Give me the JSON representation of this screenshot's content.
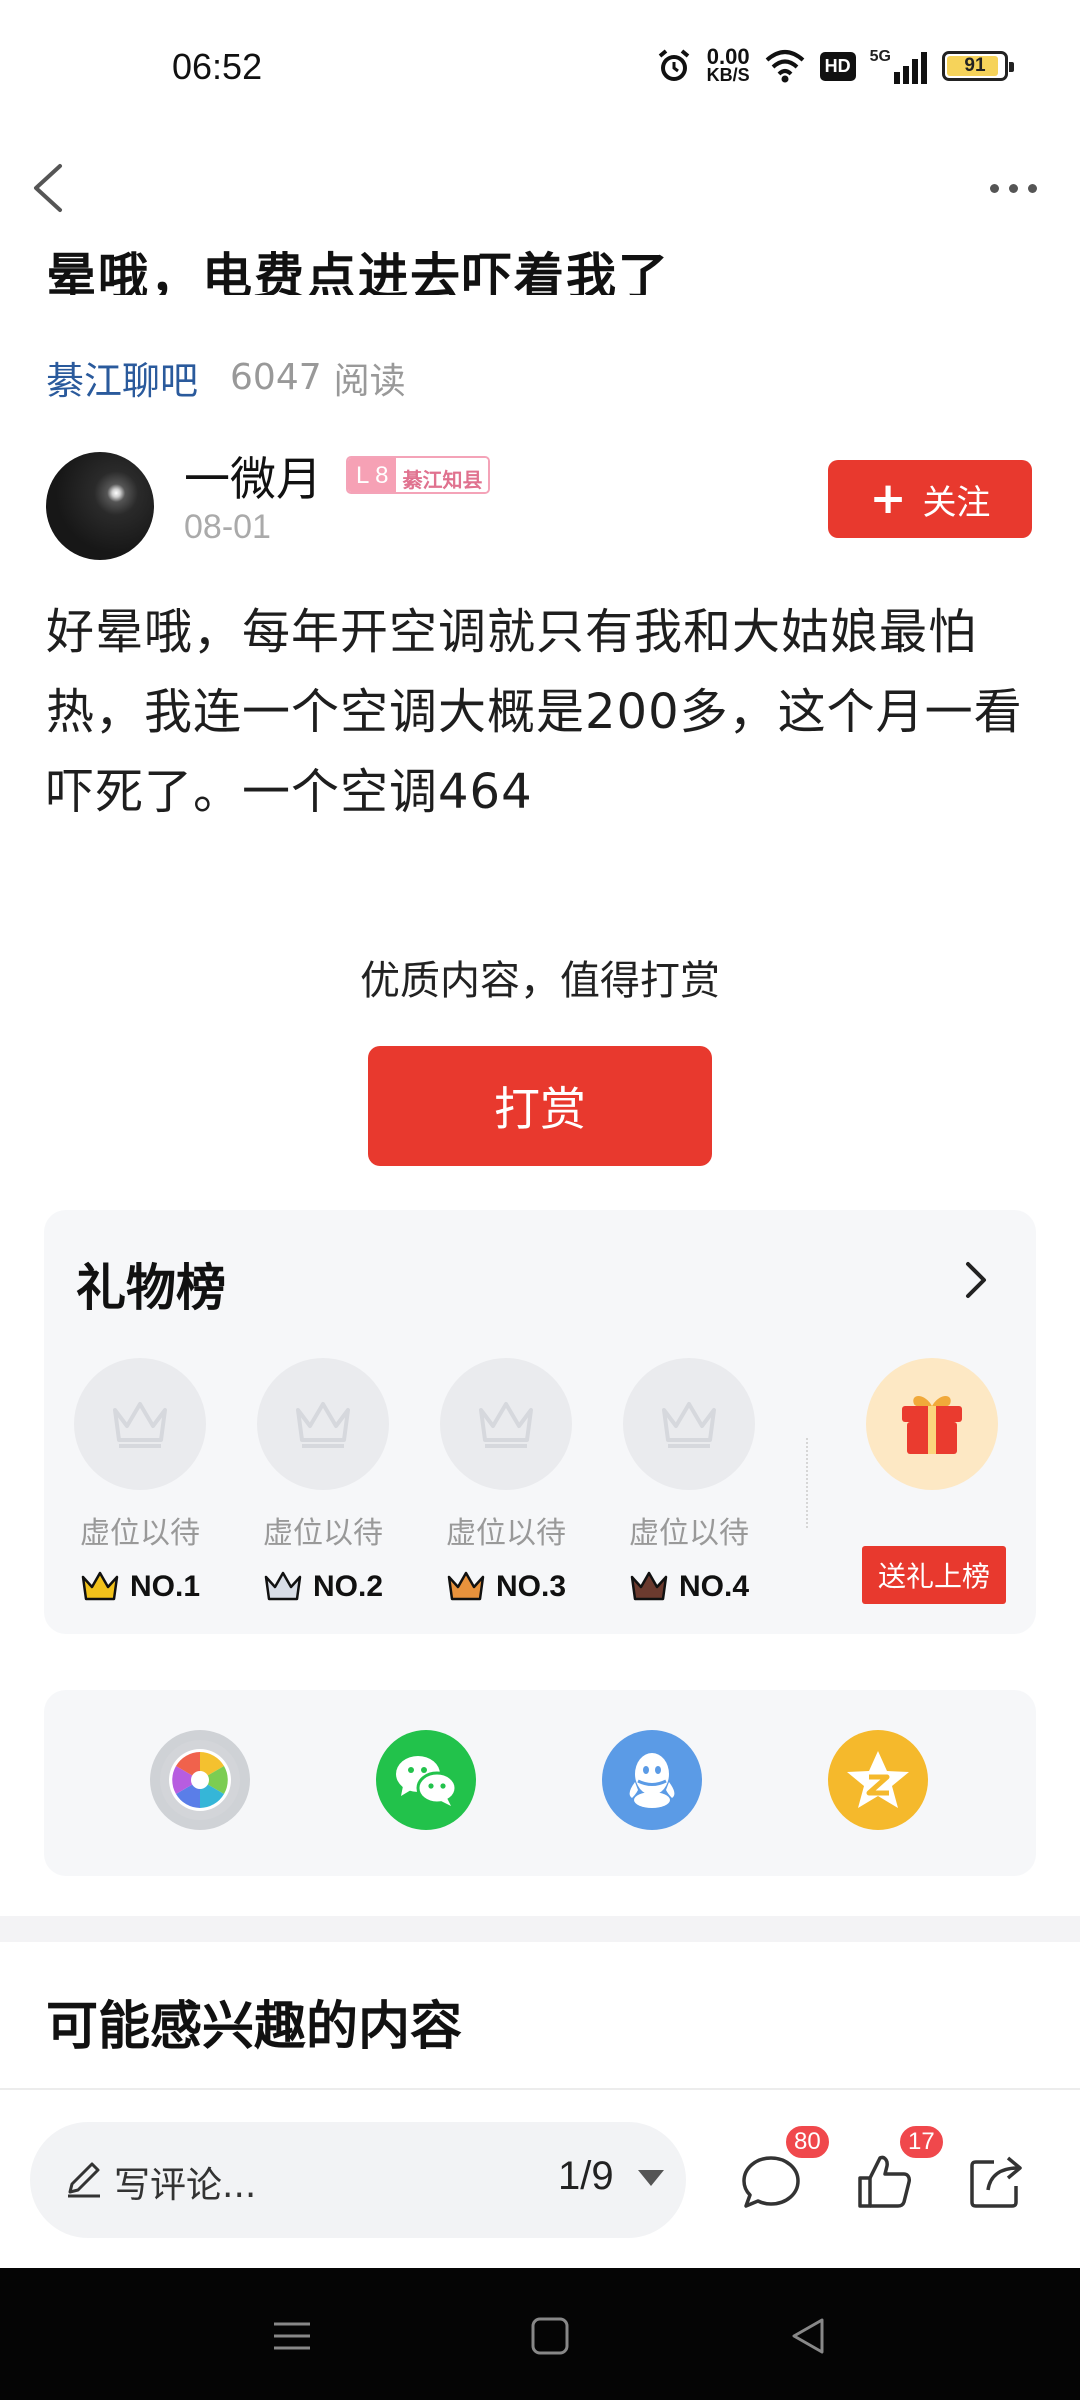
{
  "status_bar": {
    "time": "06:52",
    "net_speed_value": "0.00",
    "net_speed_unit": "KB/S",
    "hd_label": "HD",
    "signal_label": "5G",
    "battery": "91",
    "battery_level": 0.91
  },
  "post": {
    "title_partial": "晕哦，电费点进去吓着我了",
    "forum": "綦江聊吧",
    "read_count": "6047",
    "read_label": "阅读",
    "author_name": "一微月",
    "level": "L 8",
    "level_title": "綦江知县",
    "date": "08-01",
    "follow_label": "关注",
    "body": "好晕哦，每年开空调就只有我和大姑娘最怕热，我连一个空调大概是200多，这个月一看吓死了。一个空调464"
  },
  "tip": {
    "label": "优质内容，值得打赏",
    "button": "打赏"
  },
  "gift_board": {
    "title": "礼物榜",
    "slots": [
      {
        "caption": "虚位以待",
        "rank": "NO.1",
        "crown_color": "#f2c21b"
      },
      {
        "caption": "虚位以待",
        "rank": "NO.2",
        "crown_color": "#d8dde6"
      },
      {
        "caption": "虚位以待",
        "rank": "NO.3",
        "crown_color": "#e8923c"
      },
      {
        "caption": "虚位以待",
        "rank": "NO.4",
        "crown_color": "#6b3a2e"
      }
    ],
    "send_label": "送礼上榜"
  },
  "share": {
    "items": [
      "moments-icon",
      "wechat-icon",
      "qq-icon",
      "qzone-icon"
    ],
    "colors": {
      "wechat": "#22c24b",
      "qq": "#5b9be6",
      "qzone": "#f5b92c"
    }
  },
  "recommend": {
    "title": "可能感兴趣的内容"
  },
  "bottom_bar": {
    "comment_placeholder": "写评论...",
    "page_indicator": "1/9",
    "comment_count": "80",
    "like_count": "17"
  },
  "colors": {
    "accent": "#e8392e",
    "forum_link": "#2a5a9c"
  }
}
